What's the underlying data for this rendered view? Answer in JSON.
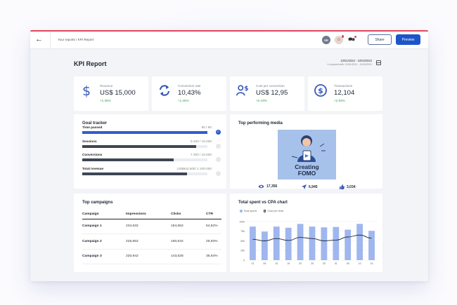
{
  "header": {
    "breadcrumb": "Your reports / KPI Report",
    "avatars": [
      "AK",
      "☺"
    ],
    "share_label": "Share",
    "preview_label": "Preview"
  },
  "report": {
    "title": "KPI Report",
    "date_range": "10/01/2022 - 10/04/2022",
    "compared_with": "Compared with: 10/01/2021 - 10/04/2021"
  },
  "kpis": [
    {
      "label": "Revenue",
      "value": "US$ 15,000",
      "delta": "+1.36%",
      "icon": "dollar-icon"
    },
    {
      "label": "Conversion rate",
      "value": "10,43%",
      "delta": "+1.45%",
      "icon": "refresh-icon"
    },
    {
      "label": "Cost per conversion",
      "value": "US$ 12,95",
      "delta": "+0.19%",
      "icon": "user-dollar-icon"
    },
    {
      "label": "Transactions",
      "value": "12,104",
      "delta": "+2.83%",
      "icon": "dollar-circle-icon"
    }
  ],
  "goal_tracker": {
    "title": "Goal tracker",
    "goals": [
      {
        "name": "Time passed",
        "value": "90 / 90",
        "progress": 1.0,
        "color": "#2f5fce",
        "done": true
      },
      {
        "name": "Sessions",
        "value": "9.100 / 10.000",
        "progress": 0.91,
        "color": "#3d4654",
        "done": false
      },
      {
        "name": "Conversions",
        "value": "7.300 / 10.000",
        "progress": 0.73,
        "color": "#3d4654",
        "done": false
      },
      {
        "name": "Total revenue",
        "value": "US$842.500/ 1.100.000",
        "progress": 0.836,
        "color": "#3d4654",
        "done": false
      }
    ]
  },
  "top_media": {
    "title": "Top performing media",
    "image_text": [
      "Creating",
      "FOMO"
    ],
    "views": "17,356",
    "shares": "6,945",
    "likes": "3,034"
  },
  "campaigns": {
    "title": "Top campaigns",
    "columns": [
      "Campaign",
      "Impressions",
      "Clicks",
      "CTR"
    ],
    "rows": [
      [
        "Campaign 1",
        "234,632",
        "154,652",
        "54,52%"
      ],
      [
        "Campaign 2",
        "225,652",
        "150,642",
        "25,93%"
      ],
      [
        "Campaign 3",
        "220,942",
        "143,528",
        "35,64%"
      ]
    ]
  },
  "spend_chart": {
    "title": "Total spent vs CPA chart",
    "legend": [
      "Total spent",
      "Cost per lead"
    ]
  },
  "colors": {
    "accent": "#1c55c9",
    "bar": "#9fb6ee",
    "line": "#222a3a",
    "positive": "#2e9e55",
    "top_border": "#e0465d"
  },
  "chart_data": {
    "type": "bar",
    "categories": [
      "01",
      "05",
      "10",
      "15",
      "20",
      "25",
      "30",
      "01",
      "05",
      "10",
      "15"
    ],
    "y_ticks": [
      "0",
      "25k",
      "50k",
      "75k",
      "100k"
    ],
    "ylim": [
      0,
      100000
    ],
    "series": [
      {
        "name": "Total spent",
        "type": "bar",
        "values": [
          87000,
          74000,
          87000,
          84000,
          94000,
          87000,
          85000,
          86000,
          79000,
          94000,
          76000
        ]
      },
      {
        "name": "Cost per lead",
        "type": "line",
        "values": [
          54000,
          50000,
          56000,
          51000,
          59000,
          56000,
          50000,
          52000,
          60000,
          65000,
          57000
        ]
      }
    ]
  }
}
